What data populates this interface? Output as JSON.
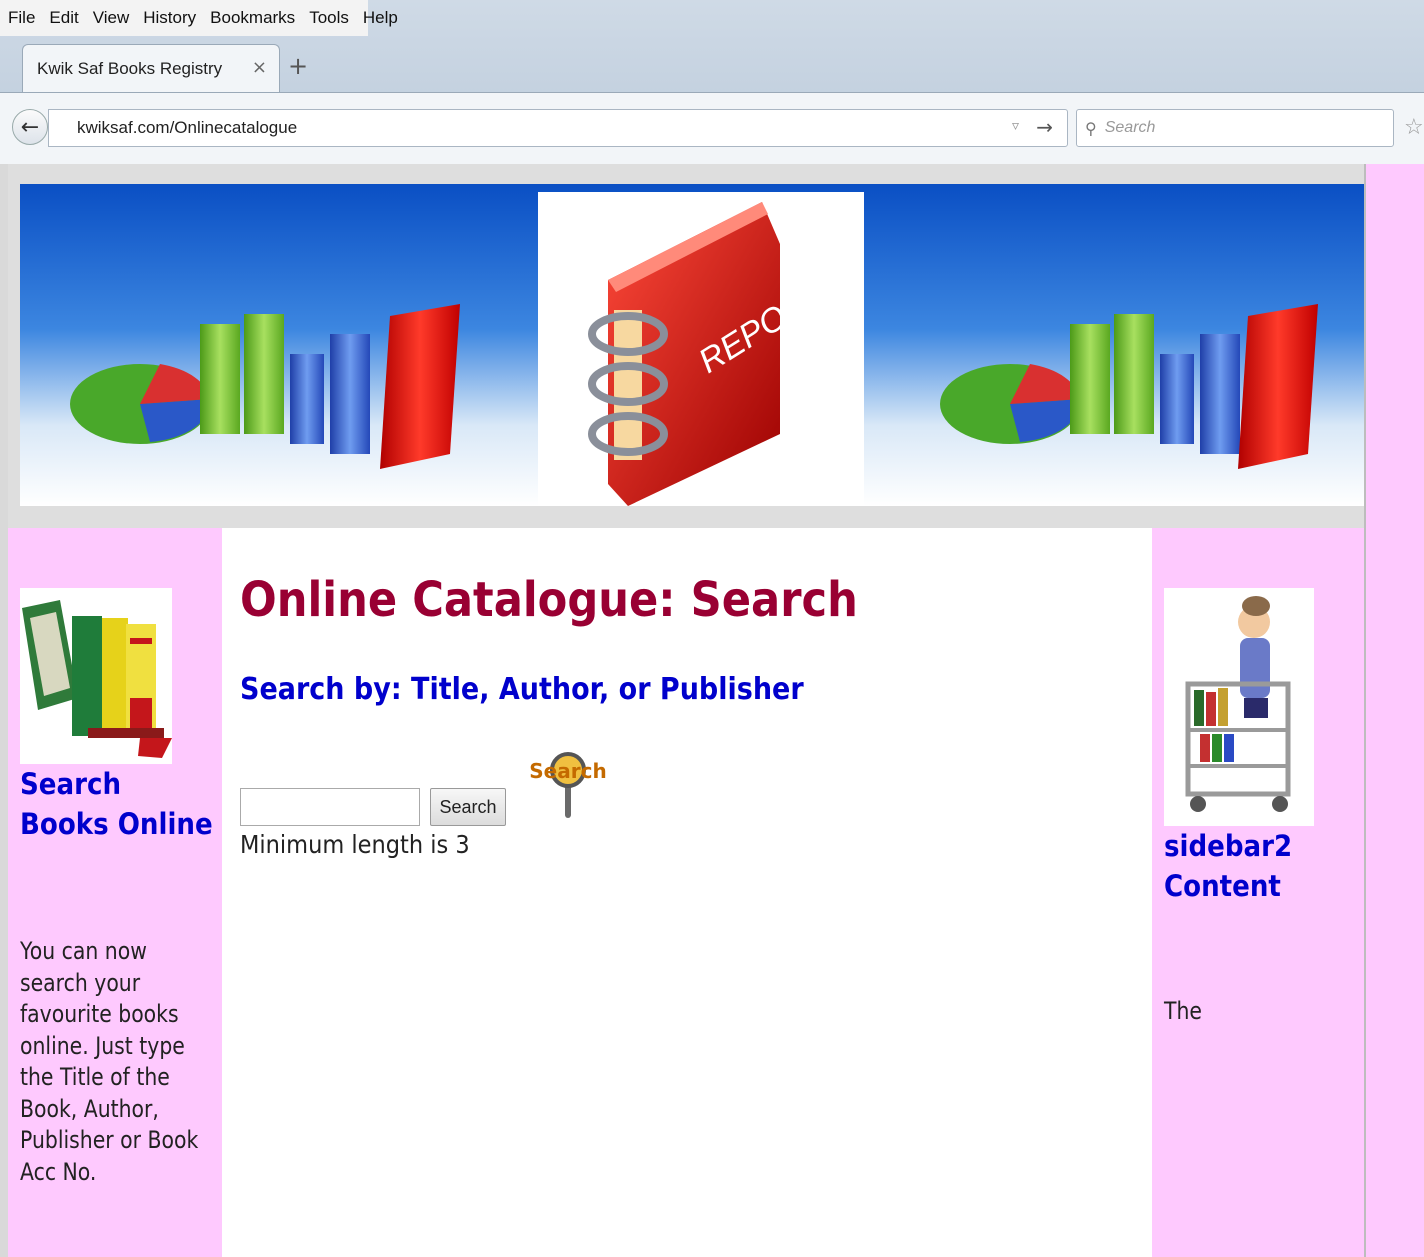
{
  "browser": {
    "menu": [
      "File",
      "Edit",
      "View",
      "History",
      "Bookmarks",
      "Tools",
      "Help"
    ],
    "tab_title": "Kwik Saf Books Registry",
    "tab_close": "×",
    "new_tab": "+",
    "url": "kwiksaf.com/Onlinecatalogue",
    "search_placeholder": "Search"
  },
  "banner": {
    "book_label": "REPORT"
  },
  "left_sidebar": {
    "heading": "Search Books Online",
    "text": "You can now search your favourite books online. Just type the Title of the Book, Author, Publisher or Book Acc No."
  },
  "main": {
    "title": "Online Catalogue: Search",
    "subtitle": "Search by: Title, Author, or Publisher",
    "search_value": "",
    "search_button": "Search",
    "search_logo_text": "Search",
    "min_length_note": "Minimum length is 3"
  },
  "right_sidebar": {
    "heading": "sidebar2 Content",
    "text": "The"
  },
  "colors": {
    "sidebar_bg": "#fec9fe",
    "title": "#990033",
    "heading": "#0000cc"
  }
}
